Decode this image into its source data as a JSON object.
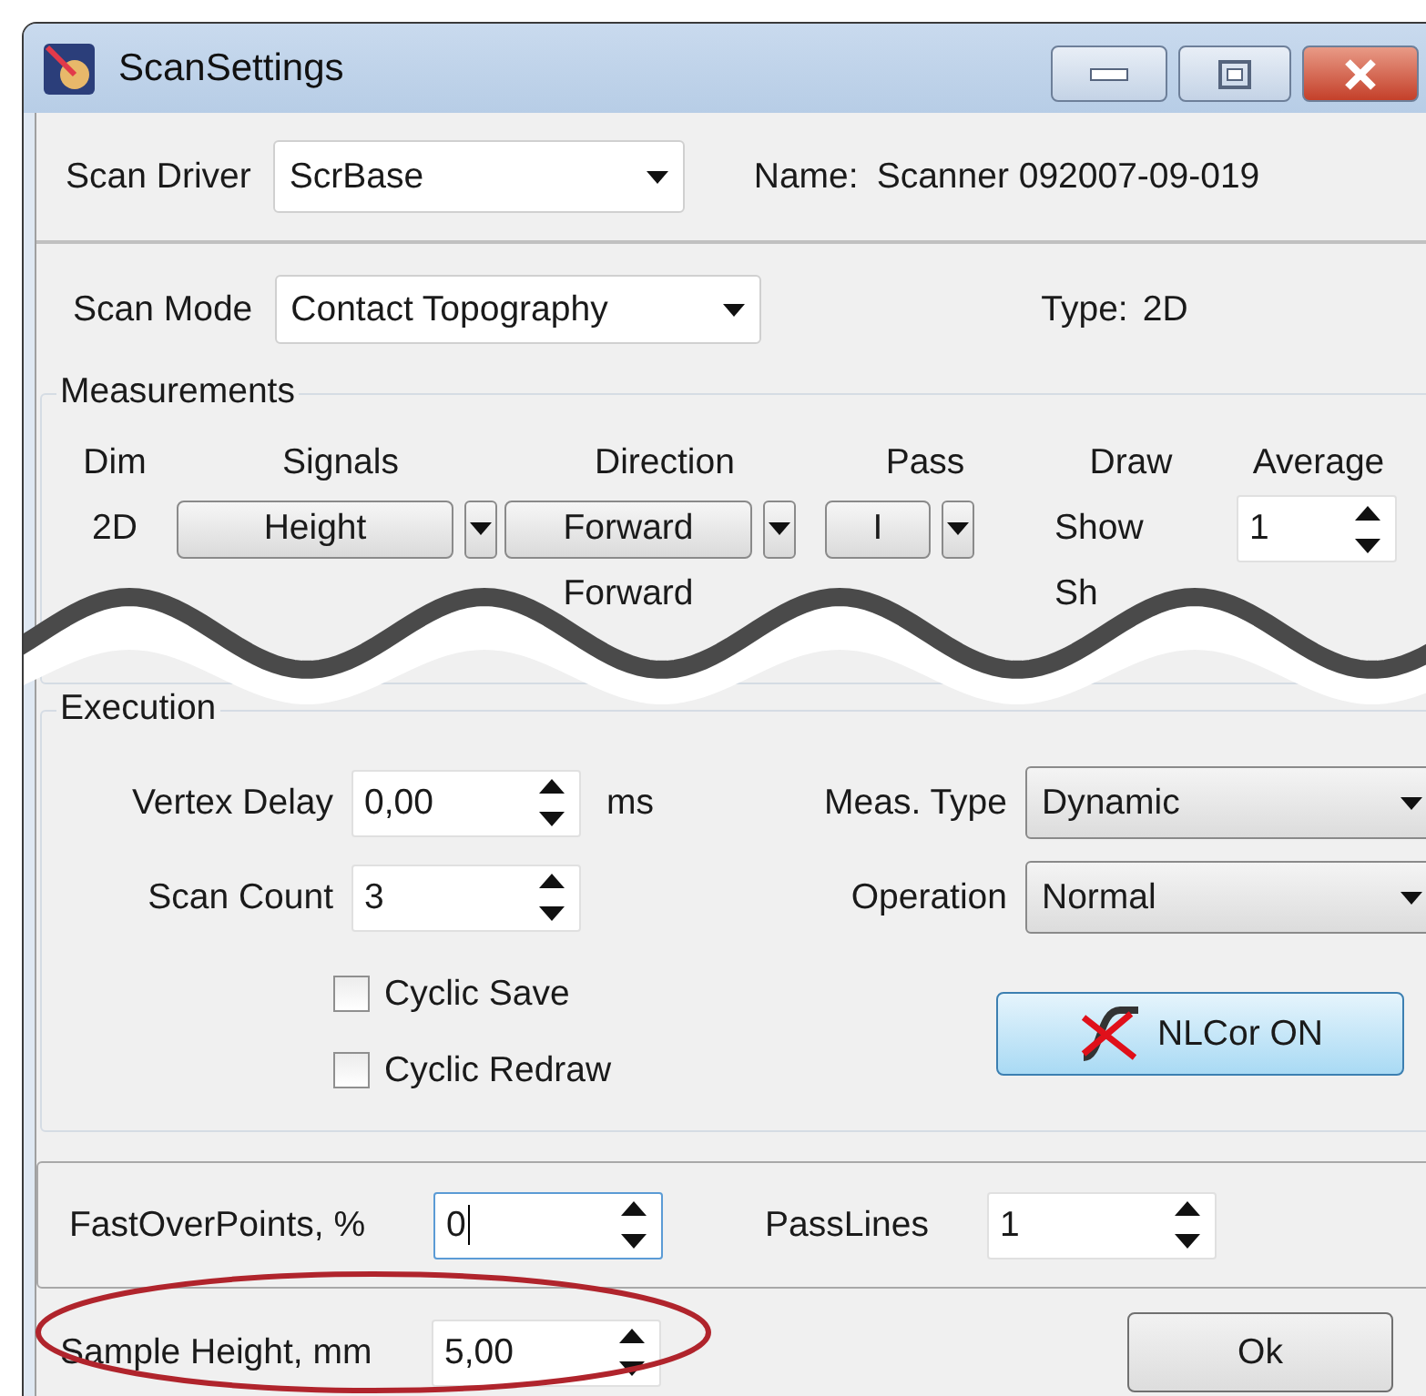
{
  "window": {
    "title": "ScanSettings"
  },
  "driver": {
    "label": "Scan Driver",
    "value": "ScrBase",
    "name_label": "Name:",
    "name_value": "Scanner 092007-09-019"
  },
  "mode": {
    "label": "Scan Mode",
    "value": "Contact Topography",
    "type_label": "Type:",
    "type_value": "2D"
  },
  "measurements": {
    "title": "Measurements",
    "columns": [
      "Dim",
      "Signals",
      "Direction",
      "Pass",
      "Draw",
      "Average"
    ],
    "rows": [
      {
        "dim": "2D",
        "signal": "Height",
        "direction": "Forward",
        "pass": "I",
        "draw": "Show",
        "average": "1"
      },
      {
        "direction": "Forward",
        "draw": "Sh"
      }
    ]
  },
  "execution": {
    "title": "Execution",
    "vertex_delay": {
      "label": "Vertex Delay",
      "value": "0,00",
      "unit": "ms"
    },
    "scan_count": {
      "label": "Scan Count",
      "value": "3"
    },
    "meas_type": {
      "label": "Meas. Type",
      "value": "Dynamic"
    },
    "operation": {
      "label": "Operation",
      "value": "Normal"
    },
    "checkboxes": [
      {
        "label": "Cyclic Save",
        "checked": false
      },
      {
        "label": "Cyclic Redraw",
        "checked": false
      }
    ],
    "nlcor_button": "NLCor ON"
  },
  "fast_over_points": {
    "label": "FastOverPoints, %",
    "value": "0",
    "focused": true
  },
  "pass_lines": {
    "label": "PassLines",
    "value": "1",
    "focused": false
  },
  "sample_height": {
    "label": "Sample Height, mm",
    "value": "5,00",
    "focused": false,
    "highlighted": true
  },
  "ok_button": "Ok"
}
